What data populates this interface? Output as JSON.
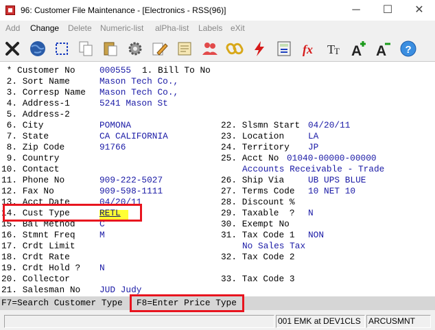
{
  "window": {
    "title": "96: Customer File Maintenance - [Electronics - RSS(96)]",
    "minimize_glyph": "─",
    "maximize_glyph": "☐",
    "close_glyph": "✕"
  },
  "menu": {
    "items": [
      {
        "label": "Add"
      },
      {
        "label": "Change"
      },
      {
        "label": "Delete"
      },
      {
        "label": "Numeric-list"
      },
      {
        "label": "alPha-list"
      },
      {
        "label": "Labels"
      },
      {
        "label": "eXit"
      }
    ]
  },
  "toolbar": {
    "buttons": [
      {
        "icon": "close-x-icon"
      },
      {
        "icon": "globe-icon"
      },
      {
        "icon": "select-box-icon"
      },
      {
        "icon": "copy-icon"
      },
      {
        "icon": "paste-icon"
      },
      {
        "icon": "settings-gear-icon"
      },
      {
        "icon": "edit-pencil-icon"
      },
      {
        "icon": "notes-icon"
      },
      {
        "icon": "users-icon"
      },
      {
        "icon": "chain-link-icon"
      },
      {
        "icon": "lightning-icon"
      },
      {
        "icon": "calculator-icon"
      },
      {
        "icon": "function-fx-icon"
      },
      {
        "icon": "font-tt-icon"
      },
      {
        "icon": "font-increase-icon"
      },
      {
        "icon": "font-decrease-icon"
      },
      {
        "icon": "help-icon"
      }
    ]
  },
  "form": {
    "left": [
      {
        "label": " * Customer No",
        "value": "000555",
        "extra": "1. Bill To No"
      },
      {
        "label": " 2. Sort Name",
        "value": "Mason Tech Co.,"
      },
      {
        "label": " 3. Corresp Name",
        "value": "Mason Tech Co.,"
      },
      {
        "label": " 4. Address-1",
        "value": "5241 Mason St"
      },
      {
        "label": " 5. Address-2",
        "value": ""
      },
      {
        "label": " 6. City",
        "value": "POMONA"
      },
      {
        "label": " 7. State",
        "value": "CA CALIFORNIA"
      },
      {
        "label": " 8. Zip Code",
        "value": "91766"
      },
      {
        "label": " 9. Country",
        "value": ""
      },
      {
        "label": "10. Contact",
        "value": ""
      },
      {
        "label": "11. Phone No",
        "value": "909-222-5027"
      },
      {
        "label": "12. Fax No",
        "value": "909-598-1111"
      },
      {
        "label": "13. Acct Date",
        "value": "04/20/11"
      },
      {
        "label": "14. Cust Type",
        "value": "RETL"
      },
      {
        "label": "15. Bal Method",
        "value": "C"
      },
      {
        "label": "16. Stmnt Freq",
        "value": "M"
      },
      {
        "label": "17. Crdt Limit",
        "value": ""
      },
      {
        "label": "18. Crdt Rate",
        "value": ""
      },
      {
        "label": "19. Crdt Hold ?",
        "value": "N"
      },
      {
        "label": "20. Collector",
        "value": ""
      },
      {
        "label": "21. Salesman No",
        "value": "JUD Judy"
      }
    ],
    "right": [
      {
        "label": "22. Slsmn Start",
        "value": "04/20/11"
      },
      {
        "label": "23. Location",
        "value": "LA"
      },
      {
        "label": "24. Territory",
        "value": "JP"
      },
      {
        "label": "25. Acct No",
        "value": "01040-00000-00000"
      },
      {
        "label": "",
        "value": "Accounts Receivable - Trade"
      },
      {
        "label": "26. Ship Via",
        "value": "UB UPS BLUE"
      },
      {
        "label": "27. Terms Code",
        "value": "10 NET 10"
      },
      {
        "label": "28. Discount %",
        "value": ""
      },
      {
        "label": "29. Taxable  ?",
        "value": "N"
      },
      {
        "label": "30. Exempt No",
        "value": ""
      },
      {
        "label": "31. Tax Code 1",
        "value": "NON"
      },
      {
        "label": "",
        "value": "No Sales Tax"
      },
      {
        "label": "32. Tax Code 2",
        "value": ""
      },
      {
        "label": "33. Tax Code 3",
        "value": ""
      }
    ]
  },
  "fkeys": {
    "f7": "F7=Search Customer Type",
    "f8": "F8=Enter Price Type"
  },
  "status": {
    "panel1": "",
    "panel2": "001 EMK at DEV1CLS",
    "panel3": "ARCUSMNT"
  },
  "colors": {
    "value_text": "#1a1aa6",
    "highlight": "#ffff33",
    "callout": "#e8141e"
  }
}
